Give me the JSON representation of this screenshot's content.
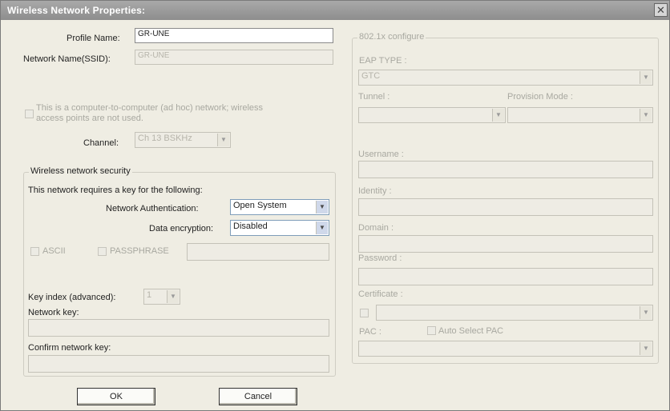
{
  "window": {
    "title": "Wireless Network Properties:",
    "close_symbol": "✕"
  },
  "profile": {
    "label": "Profile Name:",
    "value": "GR-UNE"
  },
  "ssid": {
    "label": "Network Name(SSID):",
    "value": "GR-UNE"
  },
  "adhoc": {
    "label_line1": "This is a computer-to-computer (ad hoc) network; wireless",
    "label_line2": "access points are not used."
  },
  "channel": {
    "label": "Channel:",
    "value": "Ch 13 BSKHz"
  },
  "security": {
    "legend": "Wireless network security",
    "requires_label": "This network requires a key for the following:",
    "auth_label": "Network Authentication:",
    "auth_value": "Open System",
    "enc_label": "Data encryption:",
    "enc_value": "Disabled",
    "ascii_label": "ASCII",
    "passphrase_label": "PASSPHRASE",
    "key_index_label": "Key index (advanced):",
    "key_index_value": "1",
    "network_key_label": "Network key:",
    "confirm_key_label": "Confirm network key:"
  },
  "eap": {
    "legend": "802.1x configure",
    "eap_type_label": "EAP TYPE :",
    "eap_type_value": "GTC",
    "tunnel_label": "Tunnel :",
    "provision_label": "Provision Mode :",
    "username_label": "Username :",
    "identity_label": "Identity :",
    "domain_label": "Domain :",
    "password_label": "Password :",
    "certificate_label": "Certificate :",
    "pac_label": "PAC :",
    "auto_pac_label": "Auto Select PAC"
  },
  "buttons": {
    "ok": "OK",
    "cancel": "Cancel"
  }
}
